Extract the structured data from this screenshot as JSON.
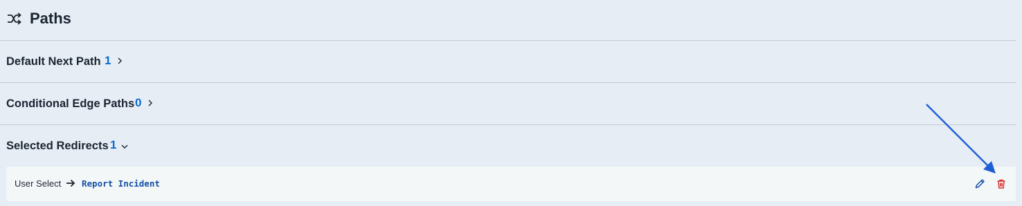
{
  "header": {
    "title": "Paths",
    "icon": "shuffle-icon"
  },
  "sections": {
    "default_next": {
      "label": "Default Next Path",
      "count": "1",
      "expanded": false
    },
    "conditional": {
      "label": "Conditional Edge Paths",
      "count": "0",
      "expanded": false
    },
    "redirects": {
      "label": "Selected Redirects",
      "count": "1",
      "expanded": true
    }
  },
  "redirect_items": [
    {
      "from": "User Select",
      "to": "Report Incident"
    }
  ],
  "colors": {
    "accent": "#0b6ad3",
    "link": "#1550a5",
    "danger": "#d32f2f",
    "annotation": "#1f5fd6"
  }
}
